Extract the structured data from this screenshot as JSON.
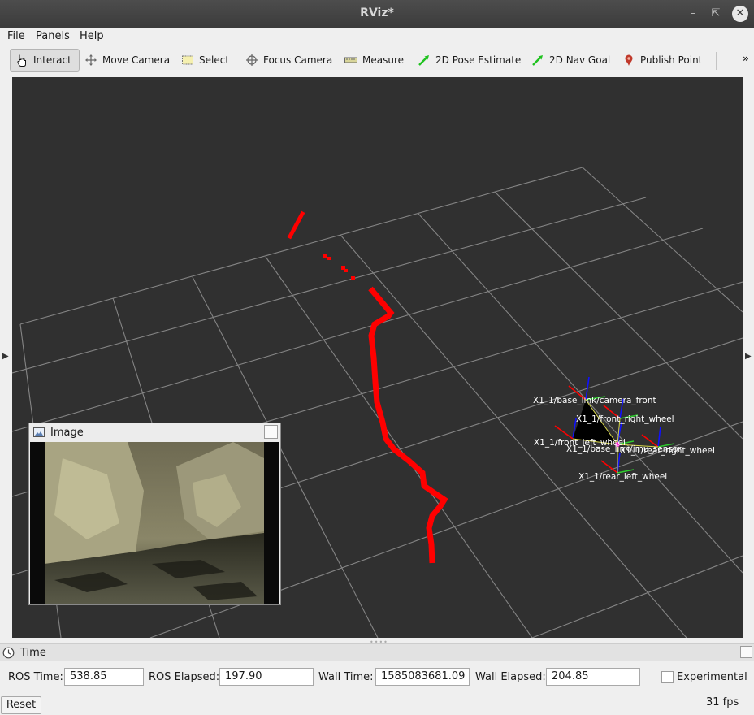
{
  "window": {
    "title": "RViz*",
    "minimize_icon": "minimize-icon",
    "maximize_icon": "maximize-icon",
    "close_icon": "close-icon"
  },
  "menu": {
    "file": "File",
    "panels": "Panels",
    "help": "Help"
  },
  "toolbar": {
    "interact": "Interact",
    "move_camera": "Move Camera",
    "select": "Select",
    "focus_camera": "Focus Camera",
    "measure": "Measure",
    "pose_estimate": "2D Pose Estimate",
    "nav_goal": "2D Nav Goal",
    "publish_point": "Publish Point",
    "more": "»"
  },
  "viewport": {
    "background": "#303030",
    "grid_color": "#a0a0a0",
    "path_color": "#ff0000",
    "frame_labels": [
      "X1_1/base_link/camera_front",
      "X1_1/front_right_wheel",
      "X1_1/front_left_wheel",
      "X1_1/base_link/imu_sensor",
      "X1_1/rear_right_wheel",
      "X1_1/rear_left_wheel"
    ]
  },
  "image_panel": {
    "title": "Image"
  },
  "time_panel": {
    "title": "Time",
    "ros_time_label": "ROS Time:",
    "ros_time": "538.85",
    "ros_elapsed_label": "ROS Elapsed:",
    "ros_elapsed": "197.90",
    "wall_time_label": "Wall Time:",
    "wall_time": "1585083681.09",
    "wall_elapsed_label": "Wall Elapsed:",
    "wall_elapsed": "204.85",
    "experimental_label": "Experimental",
    "experimental_checked": false,
    "reset_label": "Reset",
    "fps": "31 fps"
  }
}
